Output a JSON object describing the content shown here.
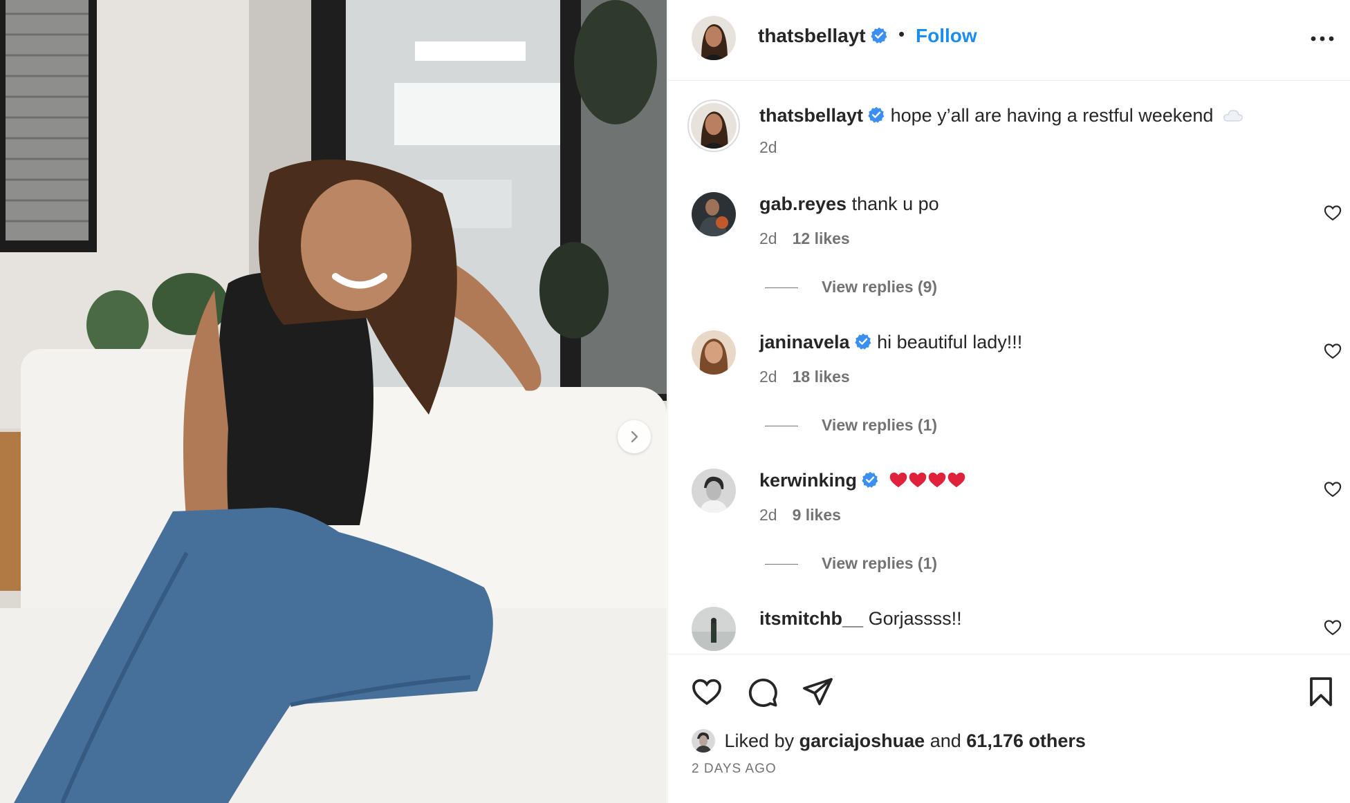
{
  "post": {
    "author": "thatsbellayt",
    "separator": "•",
    "follow_label": "Follow",
    "caption": "hope y’all are having a restful weekend",
    "caption_time": "2d"
  },
  "comments": [
    {
      "user": "gab.reyes",
      "verified": false,
      "text": "thank u po",
      "time": "2d",
      "likes": "12 likes",
      "replies": "View replies (9)"
    },
    {
      "user": "janinavela",
      "verified": true,
      "text": "hi beautiful lady!!!",
      "time": "2d",
      "likes": "18 likes",
      "replies": "View replies (1)"
    },
    {
      "user": "kerwinking",
      "verified": true,
      "text": "",
      "time": "2d",
      "likes": "9 likes",
      "replies": "View replies (1)"
    },
    {
      "user": "itsmitchb__",
      "verified": false,
      "text": "Gorjassss!!"
    }
  ],
  "likes": {
    "prefix": "Liked by",
    "user": "garciajoshuae",
    "connector": "and",
    "others": "61,176 others"
  },
  "timestamp": "2 DAYS AGO",
  "colors": {
    "follow": "#1b8cf0",
    "verified": "#3b8ff0",
    "muted": "#737373",
    "heart_emoji": "#e0213c"
  },
  "icons": [
    "verified-badge-icon",
    "more-options-icon",
    "heart-outline-icon",
    "comment-icon",
    "share-icon",
    "bookmark-icon",
    "chevron-right-icon",
    "cloud-emoji-icon",
    "red-heart-emoji-icon"
  ]
}
